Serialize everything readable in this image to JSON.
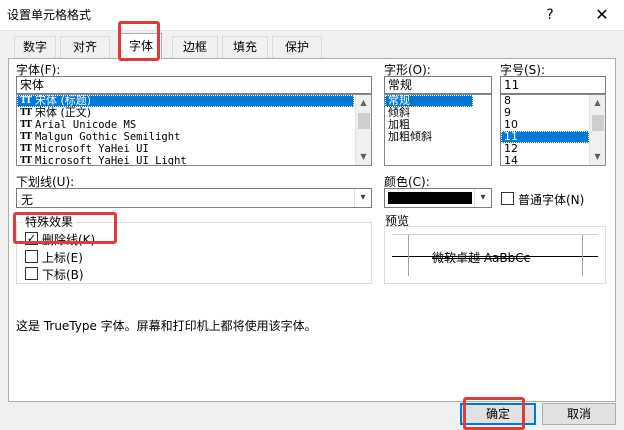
{
  "window": {
    "title": "设置单元格格式",
    "help_label": "?",
    "close_label": "✕"
  },
  "tabs": [
    {
      "label": "数字",
      "active": false
    },
    {
      "label": "对齐",
      "active": false
    },
    {
      "label": "字体",
      "active": true
    },
    {
      "label": "边框",
      "active": false
    },
    {
      "label": "填充",
      "active": false
    },
    {
      "label": "保护",
      "active": false
    }
  ],
  "font": {
    "label": "字体(F):",
    "value": "宋体",
    "list": [
      {
        "name": "宋体 (标题)",
        "selected": true,
        "mono": false
      },
      {
        "name": "宋体 (正文)",
        "selected": false,
        "mono": false
      },
      {
        "name": "Arial Unicode MS",
        "selected": false,
        "mono": true
      },
      {
        "name": "Malgun Gothic Semilight",
        "selected": false,
        "mono": true
      },
      {
        "name": "Microsoft YaHei UI",
        "selected": false,
        "mono": true
      },
      {
        "name": "Microsoft YaHei UI Light",
        "selected": false,
        "mono": true
      }
    ],
    "truetype_icon": "TT"
  },
  "style": {
    "label": "字形(O):",
    "value": "常规",
    "list": [
      {
        "name": "常规",
        "selected": true
      },
      {
        "name": "倾斜",
        "selected": false
      },
      {
        "name": "加粗",
        "selected": false
      },
      {
        "name": "加粗倾斜",
        "selected": false
      }
    ]
  },
  "size": {
    "label": "字号(S):",
    "value": "11",
    "list": [
      {
        "name": "8",
        "selected": false
      },
      {
        "name": "9",
        "selected": false
      },
      {
        "name": "10",
        "selected": false
      },
      {
        "name": "11",
        "selected": true
      },
      {
        "name": "12",
        "selected": false
      },
      {
        "name": "14",
        "selected": false
      }
    ]
  },
  "underline": {
    "label": "下划线(U):",
    "value": "无"
  },
  "color": {
    "label": "颜色(C):",
    "swatch": "#000000"
  },
  "normal_font": {
    "label": "普通字体(N)",
    "checked": false
  },
  "effects": {
    "title": "特殊效果",
    "strikethrough": {
      "label": "删除线(K)",
      "checked": true
    },
    "superscript": {
      "label": "上标(E)",
      "checked": false
    },
    "subscript": {
      "label": "下标(B)",
      "checked": false
    }
  },
  "preview": {
    "title": "预览",
    "sample": "微软卓越  AaBbCc"
  },
  "info_text": "这是 TrueType 字体。屏幕和打印机上都将使用该字体。",
  "buttons": {
    "ok": "确定",
    "cancel": "取消"
  },
  "colors": {
    "highlight": "#0078d7",
    "annotation_red": "#e03b3b"
  }
}
